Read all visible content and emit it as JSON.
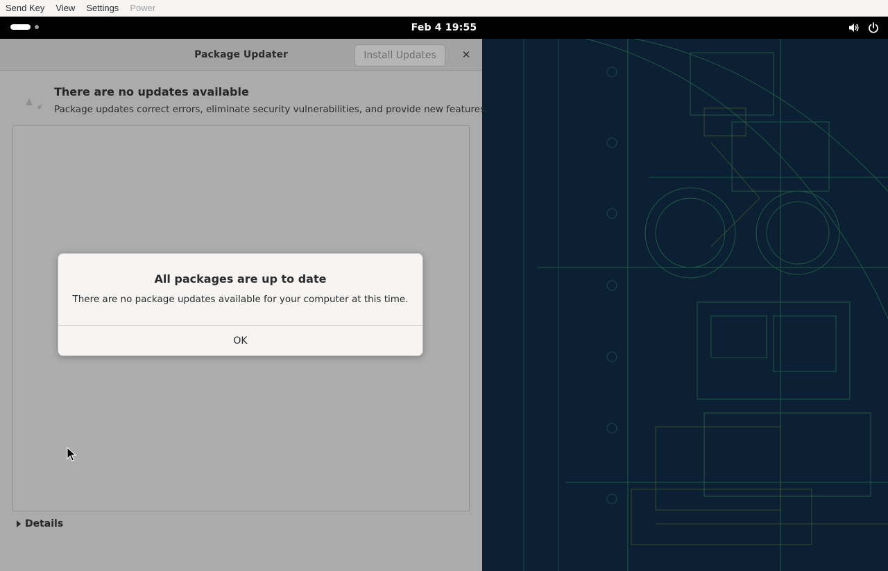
{
  "menubar": {
    "items": [
      {
        "label": "Send Key",
        "enabled": true
      },
      {
        "label": "View",
        "enabled": true
      },
      {
        "label": "Settings",
        "enabled": true
      },
      {
        "label": "Power",
        "enabled": false
      }
    ]
  },
  "topbar": {
    "clock": "Feb 4  19:55",
    "icons": [
      "activities-indicator",
      "volume-icon",
      "power-icon"
    ]
  },
  "window": {
    "title": "Package Updater",
    "install_button": "Install Updates",
    "close_glyph": "✕",
    "status_title": "There are no updates available",
    "status_subtitle": "Package updates correct errors, eliminate security vulnerabilities, and provide new features.",
    "details_label": "Details"
  },
  "dialog": {
    "title": "All packages are up to date",
    "message": "There are no package updates available for your computer at this time.",
    "ok_label": "OK"
  },
  "colors": {
    "topbar": "#000000",
    "wallpaper": "#0b2033",
    "window_dimmed": "#ababab",
    "dialog": "#f6f5f4"
  }
}
